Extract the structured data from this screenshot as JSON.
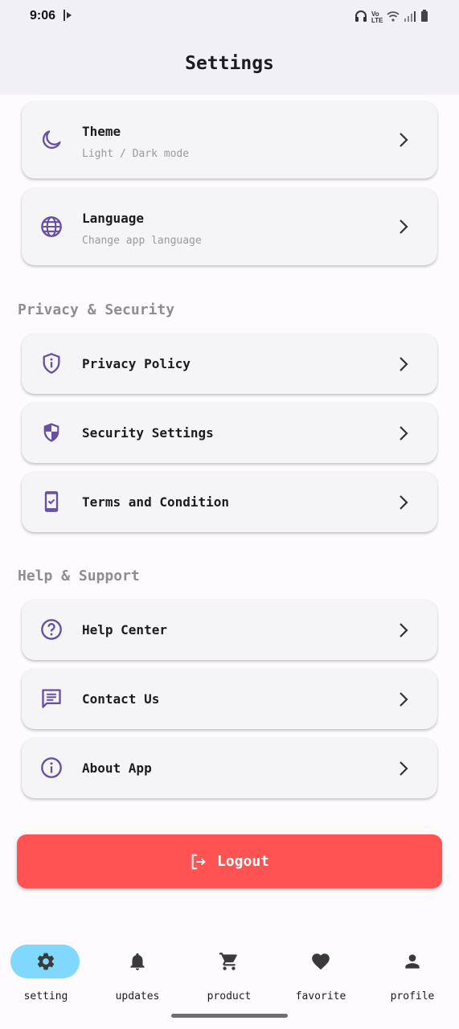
{
  "status_bar": {
    "time": "9:06",
    "network": "Vo LTE"
  },
  "appbar": {
    "title": "Settings"
  },
  "general_items": [
    {
      "title": "Theme",
      "subtitle": "Light / Dark mode",
      "icon": "moon-icon"
    },
    {
      "title": "Language",
      "subtitle": "Change app language",
      "icon": "globe-icon"
    }
  ],
  "privacy_section": {
    "header": "Privacy & Security",
    "items": [
      {
        "title": "Privacy Policy",
        "icon": "shield-info-icon"
      },
      {
        "title": "Security Settings",
        "icon": "security-shield-icon"
      },
      {
        "title": "Terms and Condition",
        "icon": "phone-check-icon"
      }
    ]
  },
  "help_section": {
    "header": "Help & Support",
    "items": [
      {
        "title": "Help Center",
        "icon": "help-circle-icon"
      },
      {
        "title": "Contact Us",
        "icon": "message-icon"
      },
      {
        "title": "About App",
        "icon": "info-icon"
      }
    ]
  },
  "logout": {
    "label": "Logout",
    "icon": "logout-icon"
  },
  "bottom_nav": {
    "active": "setting",
    "items": [
      {
        "label": "setting",
        "icon": "gear-icon"
      },
      {
        "label": "updates",
        "icon": "bell-icon"
      },
      {
        "label": "product",
        "icon": "cart-icon"
      },
      {
        "label": "favorite",
        "icon": "heart-icon"
      },
      {
        "label": "profile",
        "icon": "person-icon"
      }
    ]
  },
  "colors": {
    "accent": "#6750a4",
    "logout": "#ff5252",
    "nav_pill": "#80d8ff",
    "card": "#f5f4f6",
    "appbar": "#f1f0f6",
    "section_header": "#8e8e8e"
  }
}
